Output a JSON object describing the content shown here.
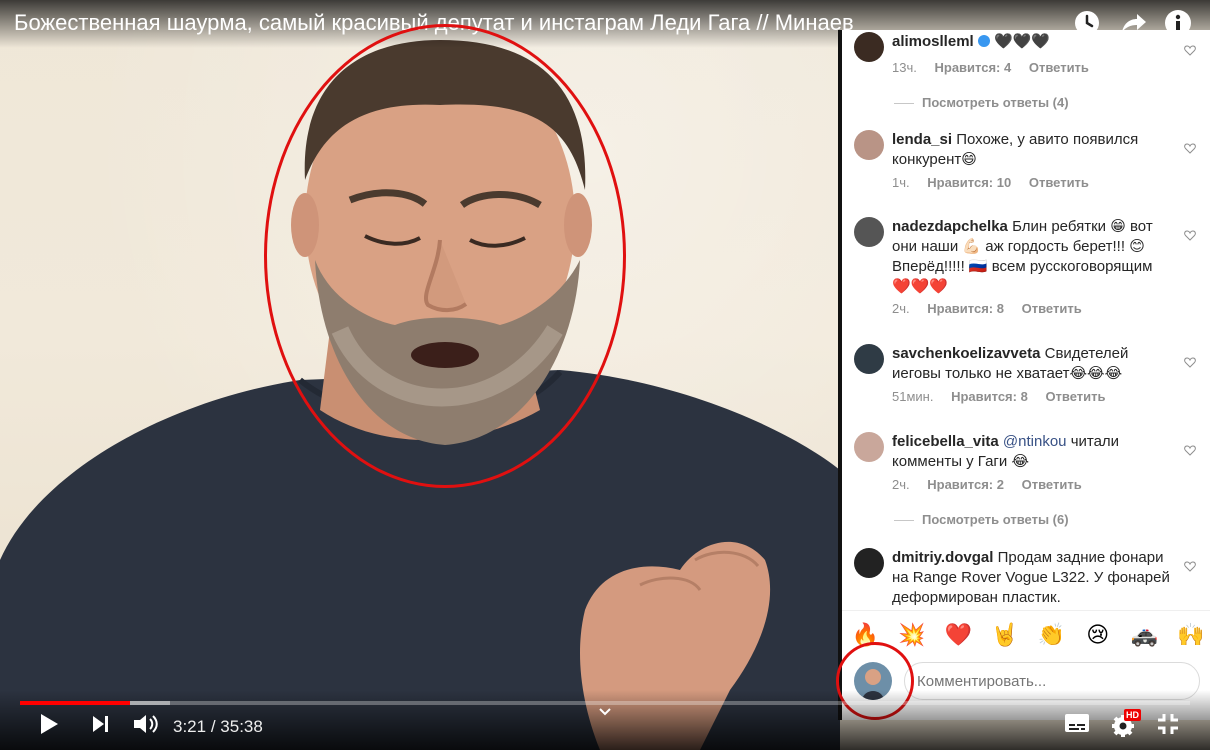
{
  "video": {
    "title": "Божественная шаурма, самый красивый депутат и инстаграм Леди Гага // Минаев",
    "current_time": "3:21",
    "duration": "35:38",
    "time_separator": "/",
    "progress_fraction": 0.094,
    "buffered_fraction": 0.128
  },
  "top_icons": [
    "clock-icon",
    "share-icon",
    "info-icon"
  ],
  "control_icons": [
    "play-icon",
    "next-icon",
    "volume-icon",
    "chevron-down-icon",
    "subtitles-icon",
    "settings-icon",
    "fullscreen-icon"
  ],
  "hd_badge": "HD",
  "instagram": {
    "comments": [
      {
        "user": "alimoslleml",
        "verified": true,
        "text": "🖤🖤🖤",
        "time": "13ч.",
        "likes": "Нравится: 4",
        "reply": "Ответить"
      },
      {
        "user": "lenda_si",
        "text": "Похоже, у авито появился конкурент😄",
        "time": "1ч.",
        "likes": "Нравится: 10",
        "reply": "Ответить"
      },
      {
        "user": "nadezdapchelka",
        "text": "Блин ребятки 😁 вот они наши 💪🏻 аж гордость берет!!! 😊 Вперёд!!!!! 🇷🇺 всем русскоговорящим ❤️❤️❤️",
        "time": "2ч.",
        "likes": "Нравится: 8",
        "reply": "Ответить"
      },
      {
        "user": "savchenkoelizavveta",
        "text": "Свидетелей иеговы только не хватает😂😂😂",
        "time": "51мин.",
        "likes": "Нравится: 8",
        "reply": "Ответить"
      },
      {
        "user": "felicebella_vita",
        "mention": "@ntinkou",
        "text": "читали комменты у Гаги 😂",
        "time": "2ч.",
        "likes": "Нравится: 2",
        "reply": "Ответить"
      },
      {
        "user": "dmitriy.dovgal",
        "text": "Продам задние фонари на Range Rover Vogue L322. У фонарей деформирован пластик."
      }
    ],
    "view_replies": [
      "Посмотреть ответы (4)",
      "Посмотреть ответы (6)"
    ],
    "emojis": [
      "🔥",
      "💥",
      "❤️",
      "🤘",
      "👏",
      "😢",
      "🚓",
      "🙌"
    ],
    "comment_placeholder": "Комментировать..."
  },
  "colors": {
    "progress_red": "#ff0000",
    "annotation_red": "#e01010",
    "ig_mention": "#385185",
    "ig_meta": "#8e8e8e"
  }
}
